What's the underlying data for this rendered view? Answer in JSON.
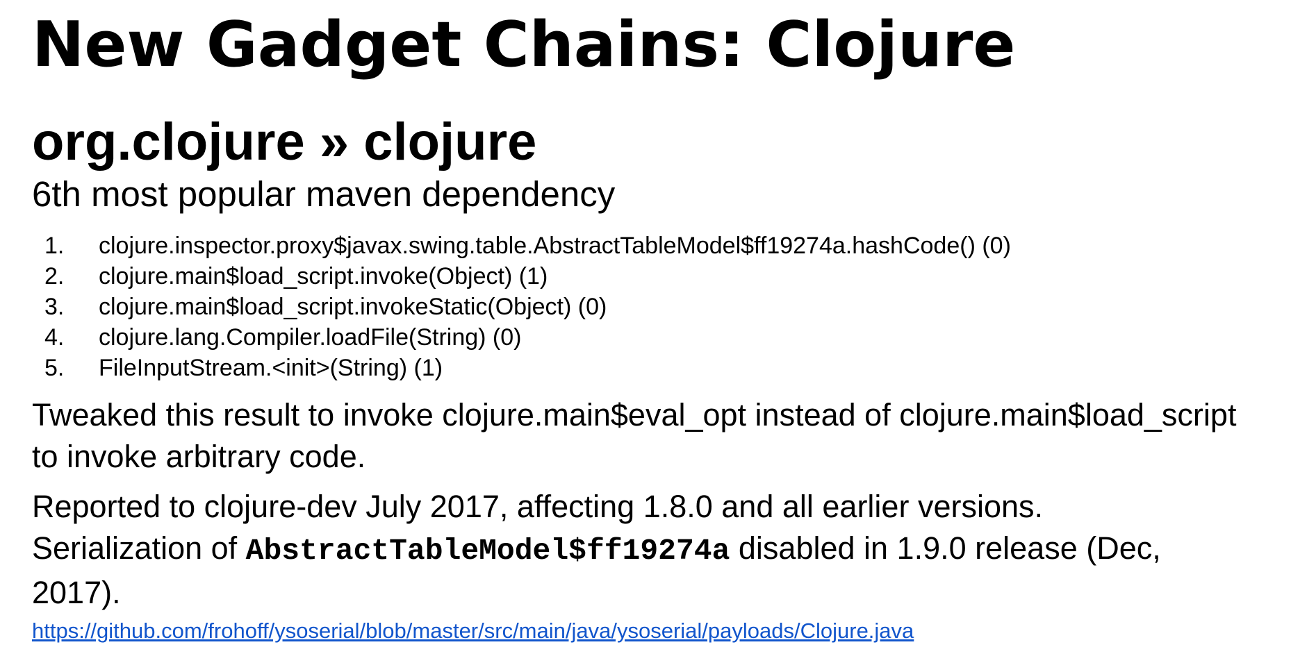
{
  "slide": {
    "title": "New Gadget Chains: Clojure",
    "subtitle": "org.clojure » clojure",
    "tagline": "6th most popular maven dependency",
    "chain": [
      {
        "num": "1.",
        "text": "clojure.inspector.proxy$javax.swing.table.AbstractTableModel$ff19274a.hashCode() (0)"
      },
      {
        "num": "2.",
        "text": "clojure.main$load_script.invoke(Object) (1)"
      },
      {
        "num": "3.",
        "text": "clojure.main$load_script.invokeStatic(Object) (0)"
      },
      {
        "num": "4.",
        "text": "clojure.lang.Compiler.loadFile(String) (0)"
      },
      {
        "num": "5.",
        "text": "FileInputStream.<init>(String) (1)"
      }
    ],
    "para1": "Tweaked this result to invoke clojure.main$eval_opt instead of clojure.main$load_script to invoke arbitrary code.",
    "para2": {
      "line1": "Reported to clojure-dev July 2017, affecting 1.8.0 and all earlier versions.",
      "pre": "Serialization of ",
      "code": "AbstractTableModel$ff19274a",
      "post": " disabled in 1.9.0 release (Dec, 2017)."
    },
    "link": "https://github.com/frohoff/ysoserial/blob/master/src/main/java/ysoserial/payloads/Clojure.java",
    "colors": {
      "text": "#000000",
      "link": "#1155cc",
      "background": "#ffffff"
    }
  }
}
